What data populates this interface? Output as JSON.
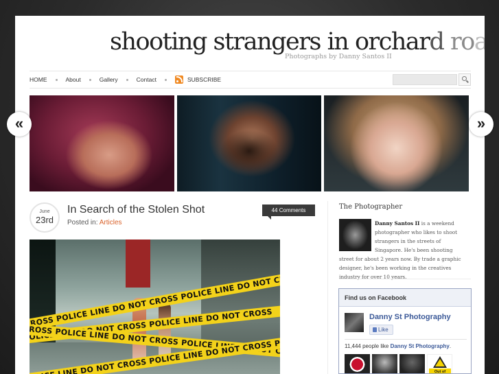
{
  "site": {
    "title_part1": "shooting strangers in orchar",
    "title_part2": "d",
    "title_part3": " ro",
    "title_part4": "ad",
    "tagline": "Photographs by Danny Santos II"
  },
  "nav": {
    "items": [
      "HOME",
      "About",
      "Gallery",
      "Contact"
    ],
    "subscribe_label": "SUBSCRIBE"
  },
  "slider": {
    "prev_label": "«",
    "next_label": "»"
  },
  "post": {
    "month": "June",
    "day": "23rd",
    "title": "In Search of the Stolen Shot",
    "posted_in_label": "Posted in:",
    "category": "Articles",
    "comments": "44 Comments",
    "tape_lines": [
      "CROSS POLICE LINE DO NOT CROSS POLICE LINE DO NOT CROSS",
      "POLICE LINE DO NOT CROSS POLICE LINE DO NOT CROSS",
      "CROSS POLICE LINE DO NOT CROSS POLICE LINE DO NOT CROSS",
      "POLICE LINE DO NOT CROSS POLICE LINE DO NOT CROSS POLICE"
    ]
  },
  "sidebar": {
    "photographer_heading": "The Photographer",
    "bio_name": "Danny Santos II",
    "bio_text": " is a weekend photographer who likes to shoot strangers in the streets of Singapore. He's been shooting street for about 2 years now. By trade a graphic designer, he's been working in the creatives industry for over 10 years.",
    "facebook": {
      "heading": "Find us on Facebook",
      "page_name": "Danny St Photography",
      "like_label": "Like",
      "count_text": "11,444 people like ",
      "count_page": "Danny St Photography",
      "count_end": ".",
      "thumb4_label": "Out of"
    }
  }
}
